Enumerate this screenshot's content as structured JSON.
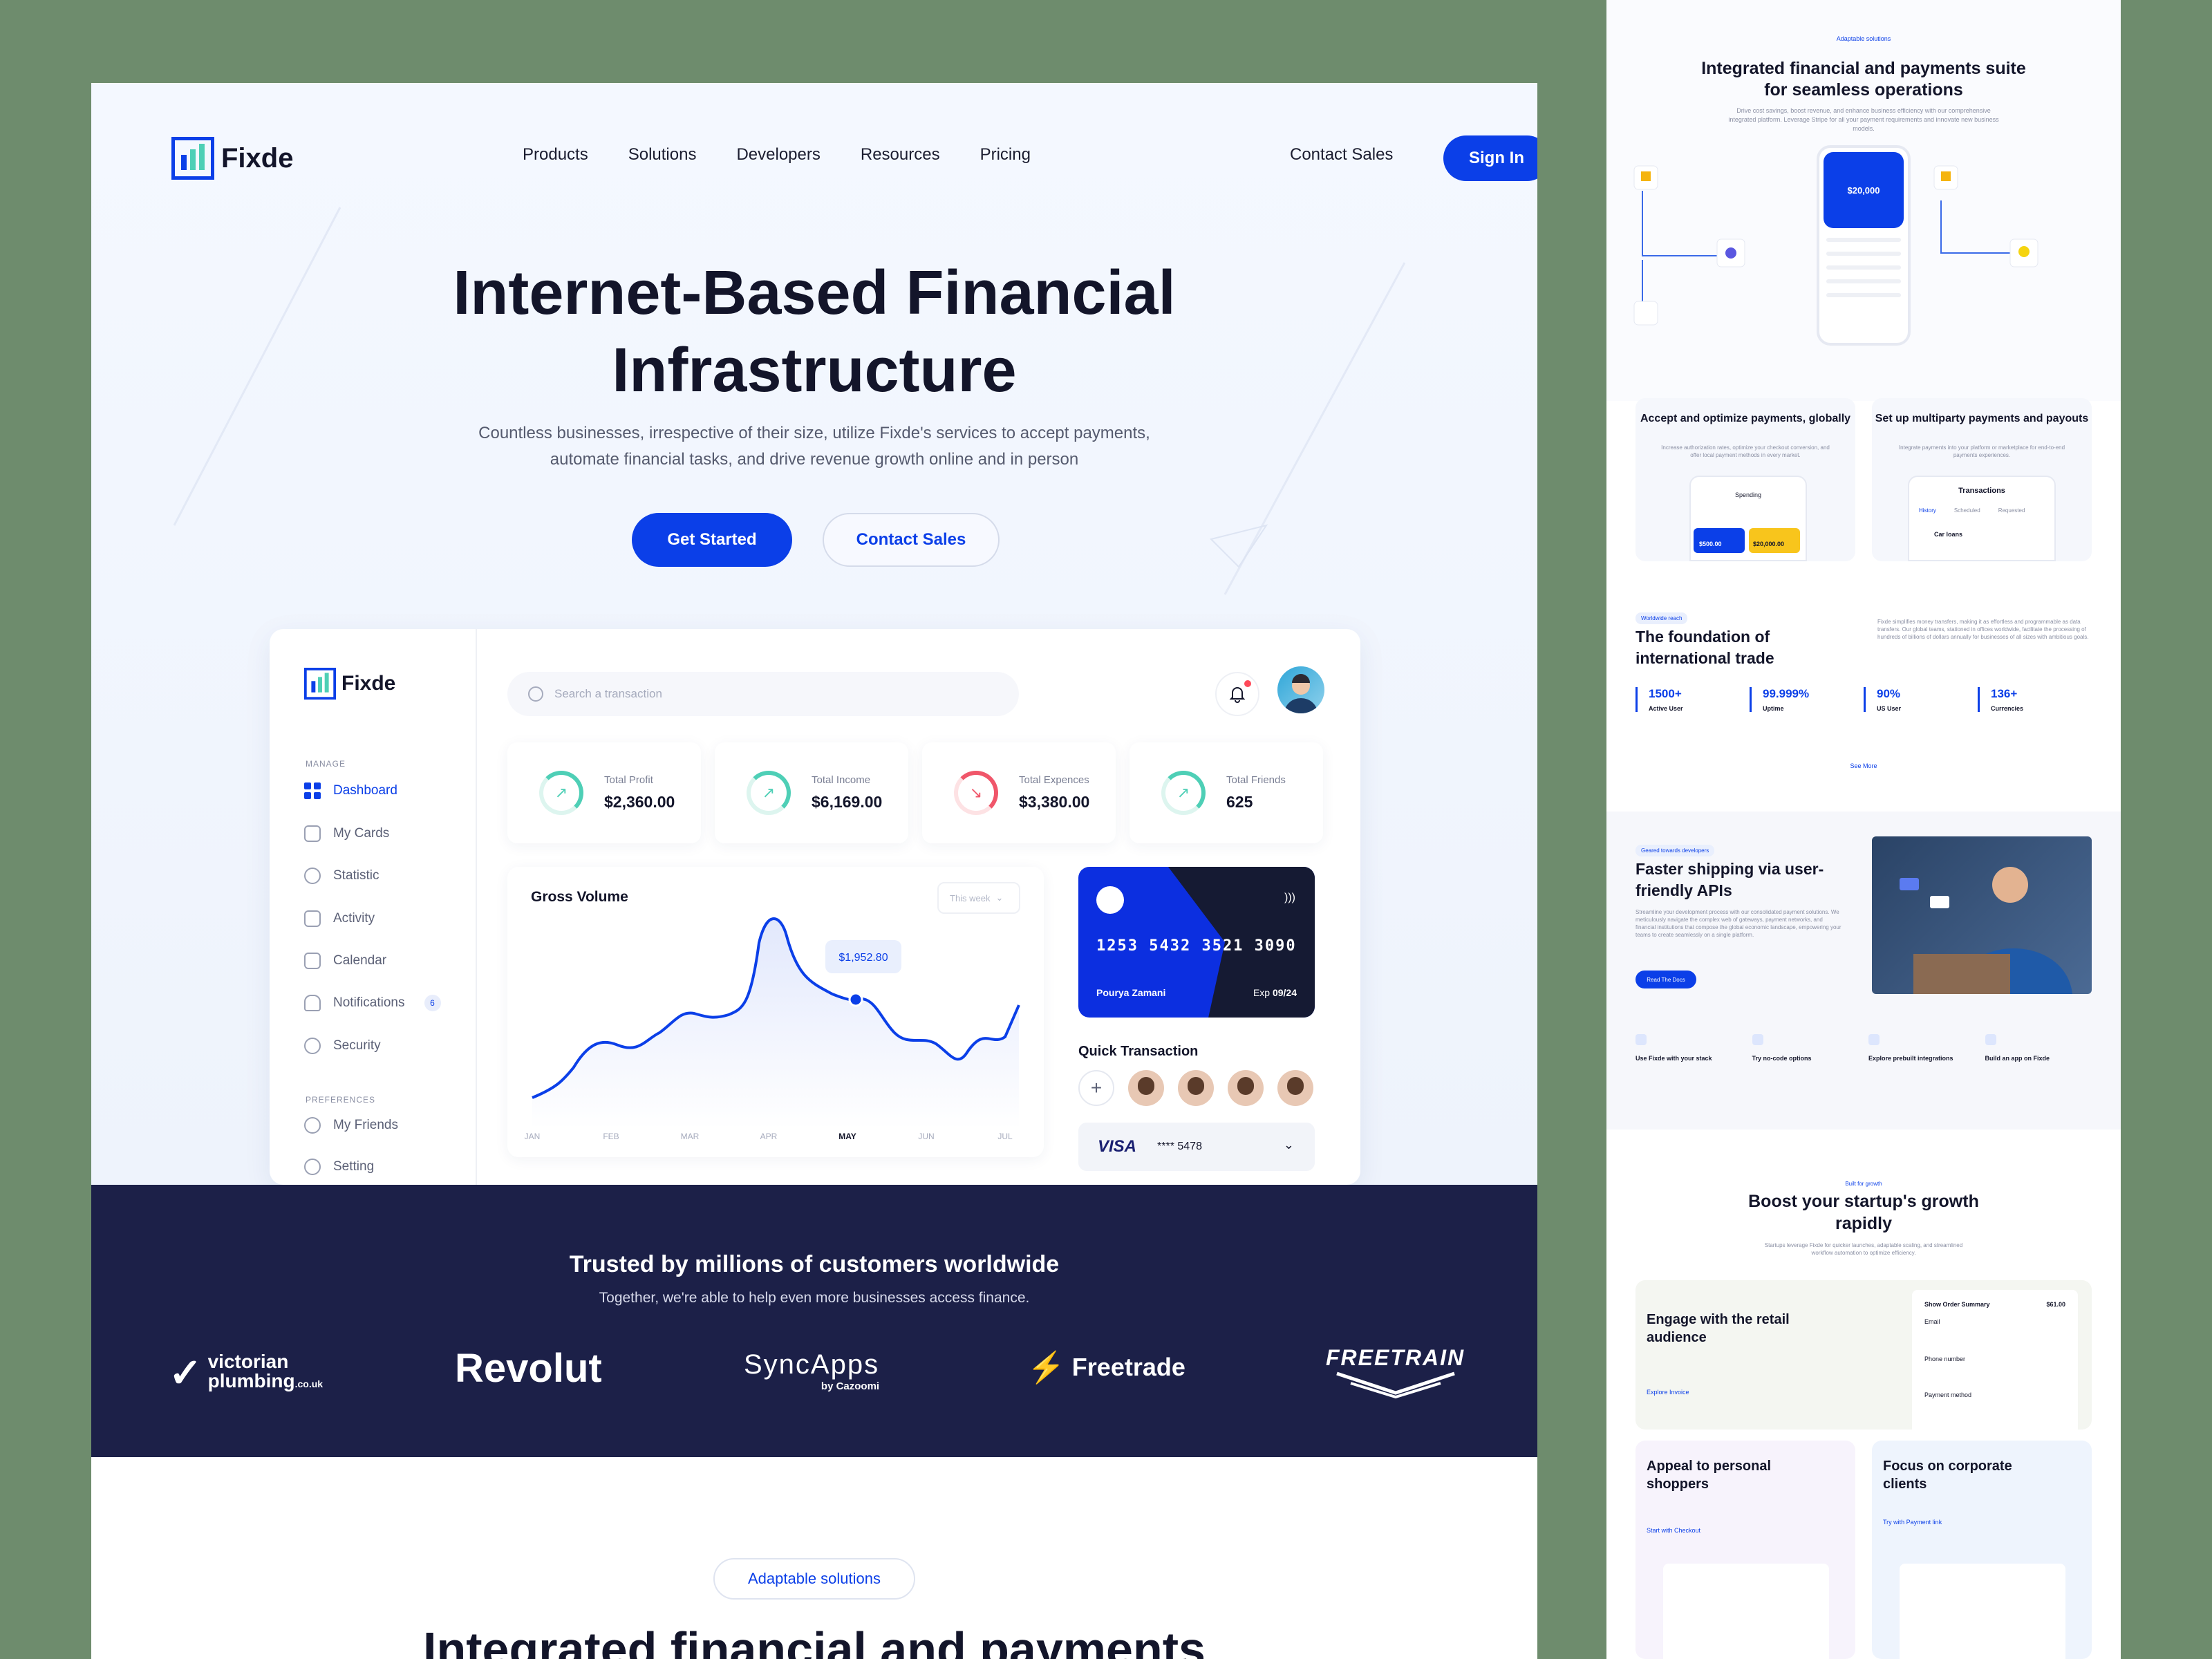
{
  "colors": {
    "primary": "#0b3fe8",
    "dark_navy": "#1c2048",
    "background": "#6e8c6d",
    "teal": "#4ecfb6",
    "red": "#f0566a"
  },
  "nav": {
    "brand": "Fixde",
    "links": [
      "Products",
      "Solutions",
      "Developers",
      "Resources",
      "Pricing"
    ],
    "contact": "Contact Sales",
    "signin": "Sign In"
  },
  "hero": {
    "title_line1": "Internet-Based Financial",
    "title_line2": "Infrastructure",
    "subtitle_line1": "Countless businesses, irrespective of their size, utilize Fixde's services to accept payments,",
    "subtitle_line2": "automate financial tasks, and drive revenue growth online and in person",
    "cta_primary": "Get Started",
    "cta_secondary": "Contact Sales"
  },
  "dashboard": {
    "brand": "Fixde",
    "manage_label": "MANAGE",
    "preferences_label": "PREFERENCES",
    "menu": [
      {
        "label": "Dashboard",
        "icon": "grid-icon"
      },
      {
        "label": "My Cards",
        "icon": "wallet-icon"
      },
      {
        "label": "Statistic",
        "icon": "chart-icon"
      },
      {
        "label": "Activity",
        "icon": "activity-icon"
      },
      {
        "label": "Calendar",
        "icon": "calendar-icon"
      },
      {
        "label": "Notifications",
        "icon": "bell-icon",
        "badge": "6"
      },
      {
        "label": "Security",
        "icon": "shield-icon"
      }
    ],
    "prefs": [
      {
        "label": "My Friends",
        "icon": "users-icon"
      },
      {
        "label": "Setting",
        "icon": "gear-icon"
      }
    ],
    "search_placeholder": "Search a transaction",
    "stats": [
      {
        "label": "Total Profit",
        "value": "$2,360.00",
        "trend": "up"
      },
      {
        "label": "Total Income",
        "value": "$6,169.00",
        "trend": "up"
      },
      {
        "label": "Total Expences",
        "value": "$3,380.00",
        "trend": "down"
      },
      {
        "label": "Total Friends",
        "value": "625",
        "trend": "up"
      }
    ],
    "gross_volume": {
      "title": "Gross Volume",
      "period": "This week",
      "tooltip": "$1,952.80",
      "months": [
        "JAN",
        "FEB",
        "MAR",
        "APR",
        "MAY",
        "JUN",
        "JUL"
      ],
      "active_month": "MAY"
    },
    "card": {
      "number": "1253 5432 3521 3090",
      "holder": "Pourya Zamani",
      "exp_label": "Exp",
      "exp": "09/24"
    },
    "quick_transaction": "Quick Transaction",
    "visa": {
      "brand": "VISA",
      "masked": "**** 5478"
    }
  },
  "chart_data": {
    "type": "area",
    "title": "Gross Volume",
    "categories": [
      "JAN",
      "FEB",
      "MAR",
      "APR",
      "MAY",
      "JUN",
      "JUL"
    ],
    "series": [
      {
        "values": [
          10,
          35,
          55,
          95,
          60,
          40,
          55
        ]
      }
    ],
    "highlight": {
      "category": "MAY",
      "label": "$1,952.80"
    }
  },
  "trusted": {
    "title": "Trusted by millions of customers worldwide",
    "subtitle": "Together, we're able to help even more businesses access finance.",
    "brands": [
      {
        "name": "victorian",
        "name2": "plumbing",
        "suffix": ".co.uk"
      },
      {
        "name": "Revolut"
      },
      {
        "name": "SyncApps",
        "sub": "by Cazoomi"
      },
      {
        "name": "Freetrade"
      },
      {
        "name": "FREETRAIN"
      }
    ]
  },
  "adaptable": {
    "badge": "Adaptable solutions",
    "title": "Integrated financial and payments"
  },
  "side": {
    "tag1": "Adaptable solutions",
    "title1": "Integrated financial and payments suite for seamless operations",
    "desc1": "Drive cost savings, boost revenue, and enhance business efficiency with our comprehensive integrated platform. Leverage Stripe for all your payment requirements and innovate new business models.",
    "phone_balance": "$20,000",
    "accept_title": "Accept and optimize payments, globally",
    "accept_desc": "Increase authorization rates, optimize your checkout conversion, and offer local payment methods in every market.",
    "spending": "Spending",
    "amount1": "$500.00",
    "amount2": "$20,000.00",
    "multi_title": "Set up multiparty payments and payouts",
    "multi_desc": "Integrate payments into your platform or marketplace for end-to-end payments experiences.",
    "transactions": "Transactions",
    "tabs": [
      "History",
      "Scheduled",
      "Requested"
    ],
    "car_loans": "Car loans",
    "tag2": "Worldwide reach",
    "found_title": "The foundation of international trade",
    "found_desc": "Fixde simplifies money transfers, making it as effortless and programmable as data transfers. Our global teams, stationed in offices worldwide, facilitate the processing of hundreds of billions of dollars annually for businesses of all sizes with ambitious goals.",
    "metrics": [
      {
        "value": "1500+",
        "label": "Active User"
      },
      {
        "value": "99.999%",
        "label": "Uptime"
      },
      {
        "value": "90%",
        "label": "US User"
      },
      {
        "value": "136+",
        "label": "Currencies"
      }
    ],
    "see_more": "See More",
    "tag3": "Geared towards developers",
    "api_title": "Faster shipping via user-friendly APIs",
    "api_desc": "Streamline your development process with our consolidated payment solutions. We meticulously navigate the complex web of gateways, payment networks, and financial institutions that compose the global economic landscape, empowering your teams to create seamlessly on a single platform.",
    "read_docs": "Read The Docs",
    "features": [
      "Use Fixde with your stack",
      "Try no-code options",
      "Explore prebuilt integrations",
      "Build an app on Fixde"
    ],
    "tag4": "Built for growth",
    "boost_title": "Boost your startup's growth rapidly",
    "boost_desc": "Startups leverage Fixde for quicker launches, adaptable scaling, and streamlined workflow automation to optimize efficiency.",
    "engage_title": "Engage with the retail audience",
    "engage_link": "Explore Invoice",
    "order_summary": "Show Order Summary",
    "order_amount": "$61.00",
    "email_label": "Email",
    "phone_label": "Phone number",
    "payment_label": "Payment method",
    "appeal_title": "Appeal to personal shoppers",
    "appeal_link": "Start with Checkout",
    "focus_title": "Focus on corporate clients",
    "focus_link": "Try with Payment link"
  }
}
